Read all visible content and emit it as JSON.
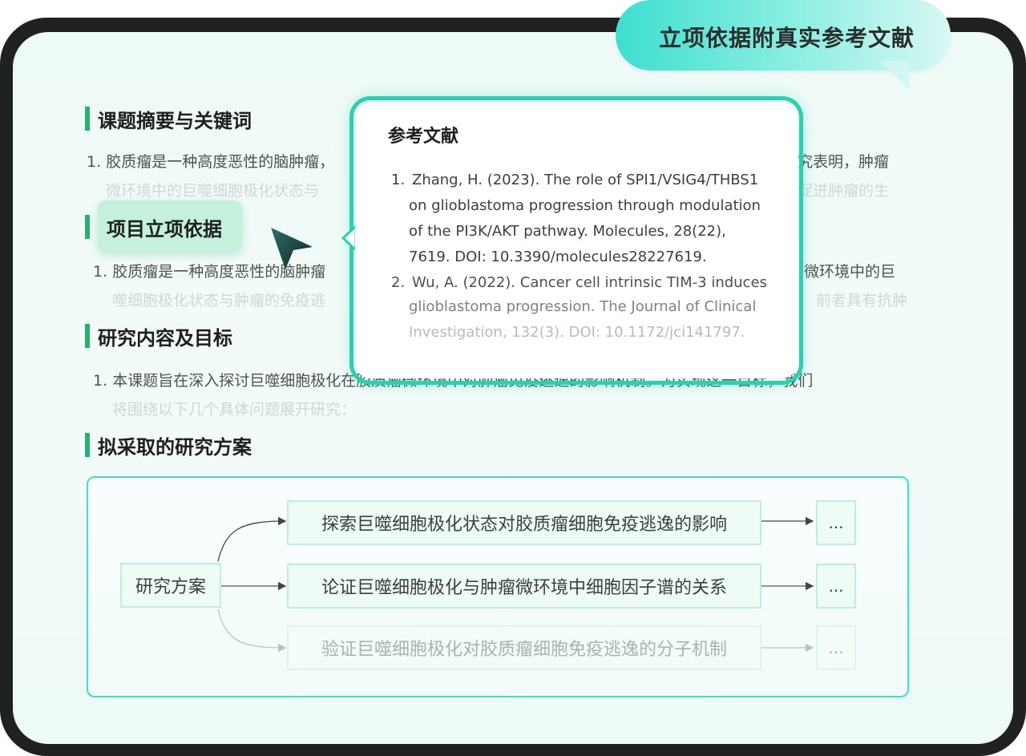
{
  "banner": {
    "title": "立项依据附真实参考文献"
  },
  "sections": [
    {
      "title": "课题摘要与关键词",
      "num": "1.",
      "line1": "胶质瘤是一种高度恶性的脑肿瘤，",
      "line1_right": "究表明，肿瘤",
      "line2": "微环境中的巨噬细胞极化状态与",
      "line2_right": "促进肿瘤的生"
    },
    {
      "title": "项目立项依据",
      "num": "1.",
      "line1": "胶质瘤是一种高度恶性的脑肿瘤",
      "line1_right": "微环境中的巨",
      "line2": "噬细胞极化状态与肿瘤的免疫逃",
      "line2_right": "前者具有抗肿"
    },
    {
      "title": "研究内容及目标",
      "num": "1.",
      "line1": "本课题旨在深入探讨巨噬细胞极化在胶质瘤微环境中对肿瘤免疫逃逸的影响机制。为实现这一目标，我们",
      "line2": "将围绕以下几个具体问题展开研究："
    },
    {
      "title": "拟采取的研究方案"
    }
  ],
  "popup": {
    "title": "参考文献",
    "references": [
      {
        "num": "1.",
        "lines": [
          "Zhang, H. (2023). The role of SPI1/VSIG4/THBS1",
          "on glioblastoma progression through modulation",
          "of the PI3K/AKT pathway. Molecules, 28(22),",
          "7619. DOI: 10.3390/molecules28227619."
        ]
      },
      {
        "num": "2.",
        "lines": [
          "Wu, A. (2022). Cancer cell intrinsic TIM-3 induces",
          "glioblastoma progression. The Journal of Clinical",
          "Investigation, 132(3). DOI: 10.1172/jci141797."
        ]
      }
    ]
  },
  "plan": {
    "root": "研究方案",
    "branches": [
      {
        "label": "探索巨噬细胞极化状态对胶质瘤细胞免疫逃逸的影响",
        "next": "..."
      },
      {
        "label": "论证巨噬细胞极化与肿瘤微环境中细胞因子谱的关系",
        "next": "..."
      },
      {
        "label": "验证巨噬细胞极化对胶质瘤细胞免疫逃逸的分子机制",
        "next": "..."
      }
    ]
  },
  "colors": {
    "accent": "#22b46f",
    "highlight": "#c5f0db",
    "popup_border": "#27d2b0",
    "banner": "#3ddfcf"
  },
  "icons": {
    "cursor": "pointer-cursor-icon"
  }
}
